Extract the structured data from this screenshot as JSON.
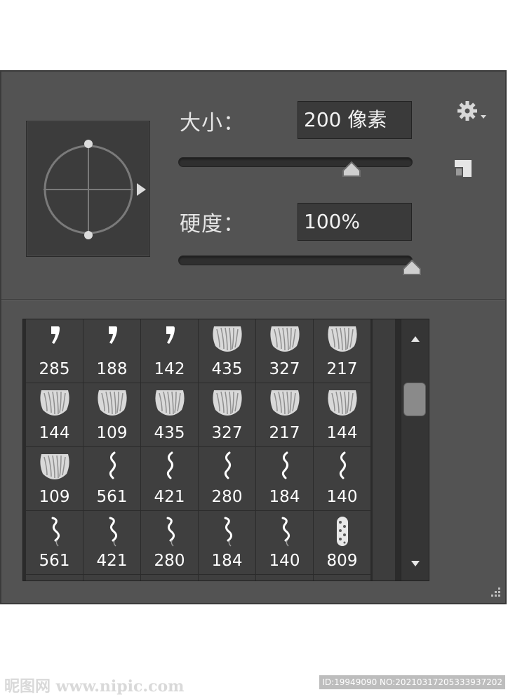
{
  "size": {
    "label": "大小：",
    "value": "200 像素",
    "slider_level": 0.74
  },
  "hardness": {
    "label": "硬度：",
    "value": "100%",
    "slider_level": 1.0
  },
  "brushes": [
    {
      "size": "285",
      "shape": "comma"
    },
    {
      "size": "188",
      "shape": "comma"
    },
    {
      "size": "142",
      "shape": "comma"
    },
    {
      "size": "435",
      "shape": "hair"
    },
    {
      "size": "327",
      "shape": "hair"
    },
    {
      "size": "217",
      "shape": "hair"
    },
    {
      "size": "144",
      "shape": "hair"
    },
    {
      "size": "109",
      "shape": "hair"
    },
    {
      "size": "435",
      "shape": "hair"
    },
    {
      "size": "327",
      "shape": "hair"
    },
    {
      "size": "217",
      "shape": "hair"
    },
    {
      "size": "144",
      "shape": "hair"
    },
    {
      "size": "109",
      "shape": "hair"
    },
    {
      "size": "561",
      "shape": "wave"
    },
    {
      "size": "421",
      "shape": "wave"
    },
    {
      "size": "280",
      "shape": "wave"
    },
    {
      "size": "184",
      "shape": "wave"
    },
    {
      "size": "140",
      "shape": "wave"
    },
    {
      "size": "561",
      "shape": "wave2"
    },
    {
      "size": "421",
      "shape": "wave2"
    },
    {
      "size": "280",
      "shape": "wave2"
    },
    {
      "size": "184",
      "shape": "wave2"
    },
    {
      "size": "140",
      "shape": "wave2"
    },
    {
      "size": "809",
      "shape": "bead"
    }
  ],
  "watermark": {
    "left": "昵图网 www.nipic.com",
    "right": "ID:19949090 NO:20210317205333937202"
  },
  "icons": {
    "gear": "gear-icon",
    "new_preset": "new-preset-icon",
    "scroll_up": "triangle-up-icon",
    "scroll_down": "triangle-down-icon",
    "resize": "resize-grip-icon"
  },
  "colors": {
    "panel": "#535353",
    "field": "#3a3a3a",
    "cell": "#3f3f3f",
    "text": "#ffffff"
  }
}
